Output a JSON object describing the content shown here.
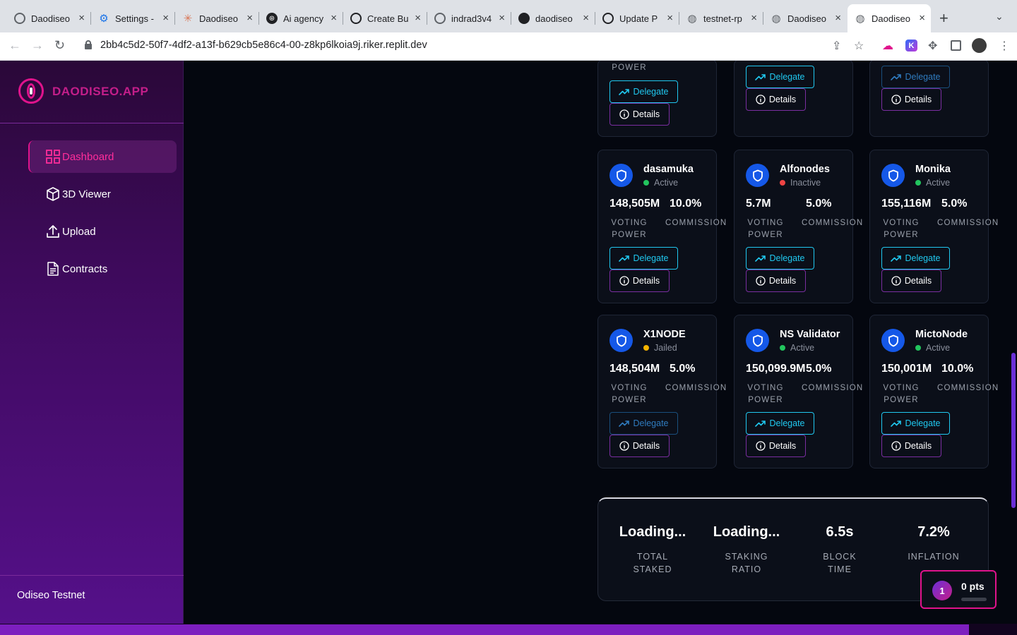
{
  "browser": {
    "tabs": [
      {
        "label": "Daodiseo",
        "icon": "gray-circle-icon"
      },
      {
        "label": "Settings -",
        "icon": "gear-icon"
      },
      {
        "label": "Daodiseo",
        "icon": "claude-icon"
      },
      {
        "label": "Ai agency",
        "icon": "openai-icon"
      },
      {
        "label": "Create Bu",
        "icon": "create-icon"
      },
      {
        "label": "indrad3v4",
        "icon": "github-outline-icon"
      },
      {
        "label": "daodiseo",
        "icon": "github-icon"
      },
      {
        "label": "Update P",
        "icon": "update-icon"
      },
      {
        "label": "testnet-rp",
        "icon": "globe-icon"
      },
      {
        "label": "Daodiseo",
        "icon": "globe-icon"
      },
      {
        "label": "Daodiseo",
        "icon": "globe-icon"
      }
    ],
    "url": "2bb4c5d2-50f7-4df2-a13f-b629cb5e86c4-00-z8kp6lkoia9j.riker.replit.dev"
  },
  "sidebar": {
    "brand": "DAODISEO.APP",
    "items": [
      {
        "label": "Dashboard",
        "icon": "grid-icon"
      },
      {
        "label": "3D Viewer",
        "icon": "cube-icon"
      },
      {
        "label": "Upload",
        "icon": "upload-icon"
      },
      {
        "label": "Contracts",
        "icon": "document-icon"
      }
    ],
    "network": "Odiseo Testnet"
  },
  "labels": {
    "voting": "VOTING",
    "power": "POWER",
    "commission": "COMMISSION",
    "delegate": "Delegate",
    "details": "Details"
  },
  "validators_top": [
    {
      "delegate_disabled": false
    },
    {
      "delegate_disabled": false
    },
    {
      "delegate_disabled": true
    }
  ],
  "validators": [
    {
      "name": "dasamuka",
      "status": "Active",
      "status_color": "#22c55e",
      "voting_power": "148,505M",
      "commission": "10.0%",
      "delegate_disabled": false
    },
    {
      "name": "Alfonodes",
      "status": "Inactive",
      "status_color": "#ef4444",
      "voting_power": "5.7M",
      "commission": "5.0%",
      "delegate_disabled": false
    },
    {
      "name": "Monika",
      "status": "Active",
      "status_color": "#22c55e",
      "voting_power": "155,116M",
      "commission": "5.0%",
      "delegate_disabled": false
    },
    {
      "name": "X1NODE",
      "status": "Jailed",
      "status_color": "#f5b400",
      "voting_power": "148,504M",
      "commission": "5.0%",
      "delegate_disabled": true
    },
    {
      "name": "NS Validator",
      "status": "Active",
      "status_color": "#22c55e",
      "voting_power": "150,099.9M",
      "commission": "5.0%",
      "delegate_disabled": false
    },
    {
      "name": "MictoNode",
      "status": "Active",
      "status_color": "#22c55e",
      "voting_power": "150,001M",
      "commission": "10.0%",
      "delegate_disabled": false
    }
  ],
  "stats": [
    {
      "value": "Loading...",
      "label_l1": "TOTAL",
      "label_l2": "STAKED"
    },
    {
      "value": "Loading...",
      "label_l1": "STAKING",
      "label_l2": "RATIO"
    },
    {
      "value": "6.5s",
      "label_l1": "BLOCK",
      "label_l2": "TIME"
    },
    {
      "value": "7.2%",
      "label_l1": "INFLATION",
      "label_l2": ""
    }
  ],
  "points": {
    "badge": "1",
    "value": "0 pts"
  },
  "colors": {
    "accent": "#e0138c",
    "delegate": "#20c8f0",
    "details_border": "#7a2ea0",
    "shield": "#1558e8"
  }
}
